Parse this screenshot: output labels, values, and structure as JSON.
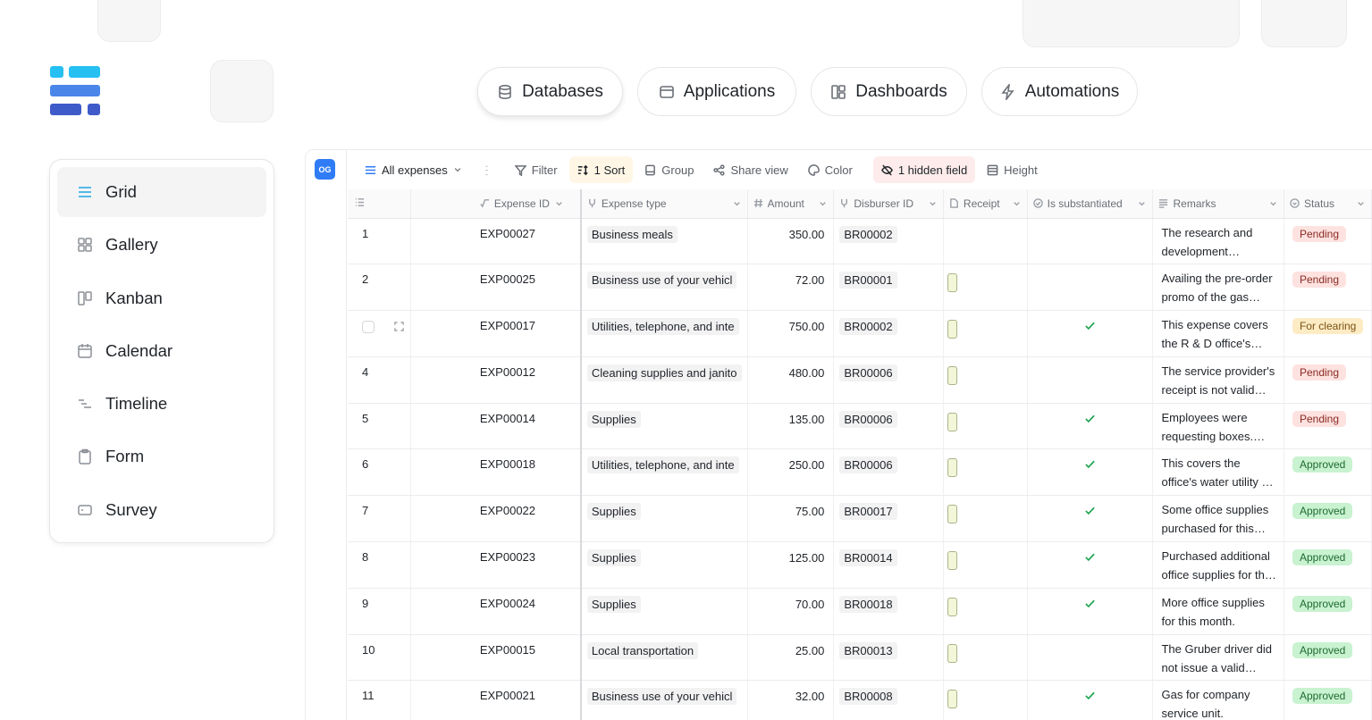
{
  "nav": {
    "tabs": [
      {
        "label": "Databases",
        "icon": "database-icon"
      },
      {
        "label": "Applications",
        "icon": "window-icon"
      },
      {
        "label": "Dashboards",
        "icon": "dashboard-icon"
      },
      {
        "label": "Automations",
        "icon": "lightning-icon"
      }
    ]
  },
  "sidebar": {
    "items": [
      {
        "label": "Grid",
        "icon": "grid-lines-icon"
      },
      {
        "label": "Gallery",
        "icon": "gallery-icon"
      },
      {
        "label": "Kanban",
        "icon": "kanban-icon"
      },
      {
        "label": "Calendar",
        "icon": "calendar-icon"
      },
      {
        "label": "Timeline",
        "icon": "timeline-icon"
      },
      {
        "label": "Form",
        "icon": "clipboard-icon"
      },
      {
        "label": "Survey",
        "icon": "survey-icon"
      }
    ]
  },
  "base": {
    "initials": "OG",
    "color": "#2f7cf6"
  },
  "toolbar": {
    "view_name": "All expenses",
    "filter": "Filter",
    "sort": "1 Sort",
    "group": "Group",
    "share": "Share view",
    "color": "Color",
    "hidden": "1 hidden field",
    "height": "Height"
  },
  "columns": {
    "expense_id": "Expense ID",
    "expense_type": "Expense type",
    "amount": "Amount",
    "disburser_id": "Disburser ID",
    "receipt": "Receipt",
    "substantiated": "Is substantiated",
    "remarks": "Remarks",
    "status": "Status"
  },
  "status_colors": {
    "Pending": {
      "bg": "#fde2e0",
      "fg": "#8a2a22"
    },
    "For clearing": {
      "bg": "#fdebc4",
      "fg": "#7a5211"
    },
    "Approved": {
      "bg": "#c9f2d0",
      "fg": "#1d6b30"
    }
  },
  "rows": [
    {
      "num": "1",
      "id": "EXP00027",
      "type": "Business meals",
      "amount": "350.00",
      "disburser": "BR00002",
      "receipt": false,
      "substantiated": false,
      "remarks": "The research and development department i...",
      "status": "Pending"
    },
    {
      "num": "2",
      "id": "EXP00025",
      "type": "Business use of your vehicl",
      "amount": "72.00",
      "disburser": "BR00001",
      "receipt": true,
      "substantiated": false,
      "remarks": "Availing the pre-order promo of the gas company.",
      "status": "Pending"
    },
    {
      "num": "",
      "id": "EXP00017",
      "type": "Utilities, telephone, and inte",
      "amount": "750.00",
      "disburser": "BR00002",
      "receipt": true,
      "substantiated": true,
      "remarks": "This expense covers the R & D office's internet and...",
      "status": "For clearing",
      "hover": true
    },
    {
      "num": "4",
      "id": "EXP00012",
      "type": "Cleaning supplies and janito",
      "amount": "480.00",
      "disburser": "BR00006",
      "receipt": true,
      "substantiated": false,
      "remarks": "The service provider's receipt is not valid for...",
      "status": "Pending"
    },
    {
      "num": "5",
      "id": "EXP00014",
      "type": "Supplies",
      "amount": "135.00",
      "disburser": "BR00006",
      "receipt": true,
      "substantiated": true,
      "remarks": "Employees were requesting boxes. Ordered several for...",
      "status": "Pending"
    },
    {
      "num": "6",
      "id": "EXP00018",
      "type": "Utilities, telephone, and inte",
      "amount": "250.00",
      "disburser": "BR00006",
      "receipt": true,
      "substantiated": true,
      "remarks": "This covers the office's water utility bill for the...",
      "status": "Approved"
    },
    {
      "num": "7",
      "id": "EXP00022",
      "type": "Supplies",
      "amount": "75.00",
      "disburser": "BR00017",
      "receipt": true,
      "substantiated": true,
      "remarks": "Some office supplies purchased for this month.",
      "status": "Approved"
    },
    {
      "num": "8",
      "id": "EXP00023",
      "type": "Supplies",
      "amount": "125.00",
      "disburser": "BR00014",
      "receipt": true,
      "substantiated": true,
      "remarks": "Purchased additional office supplies for this month.",
      "status": "Approved"
    },
    {
      "num": "9",
      "id": "EXP00024",
      "type": "Supplies",
      "amount": "70.00",
      "disburser": "BR00018",
      "receipt": true,
      "substantiated": true,
      "remarks": "More office supplies for this month.",
      "status": "Approved"
    },
    {
      "num": "10",
      "id": "EXP00015",
      "type": "Local transportation",
      "amount": "25.00",
      "disburser": "BR00013",
      "receipt": true,
      "substantiated": false,
      "remarks": "The Gruber driver did not issue a valid official receipt.",
      "status": "Approved"
    },
    {
      "num": "11",
      "id": "EXP00021",
      "type": "Business use of your vehicl",
      "amount": "32.00",
      "disburser": "BR00008",
      "receipt": true,
      "substantiated": true,
      "remarks": "Gas for company service unit.",
      "status": "Approved"
    }
  ]
}
